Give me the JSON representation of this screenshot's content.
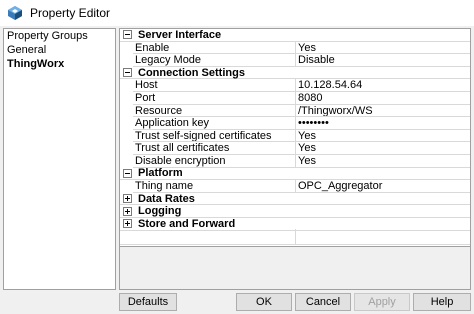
{
  "window": {
    "title": "Property Editor",
    "icon": "thingworx-app-icon"
  },
  "groups": {
    "items": [
      {
        "label": "Property Groups",
        "bold": false
      },
      {
        "label": "General",
        "bold": false
      },
      {
        "label": "ThingWorx",
        "bold": true
      }
    ]
  },
  "grid": {
    "categories": [
      {
        "label": "Server Interface",
        "expanded": true,
        "props": [
          {
            "name": "Enable",
            "value": "Yes"
          },
          {
            "name": "Legacy Mode",
            "value": "Disable"
          }
        ]
      },
      {
        "label": "Connection Settings",
        "expanded": true,
        "props": [
          {
            "name": "Host",
            "value": "10.128.54.64"
          },
          {
            "name": "Port",
            "value": "8080"
          },
          {
            "name": "Resource",
            "value": "/Thingworx/WS"
          },
          {
            "name": "Application key",
            "value": "••••••••"
          },
          {
            "name": "Trust self-signed certificates",
            "value": "Yes"
          },
          {
            "name": "Trust all certificates",
            "value": "Yes"
          },
          {
            "name": "Disable encryption",
            "value": "Yes"
          }
        ]
      },
      {
        "label": "Platform",
        "expanded": true,
        "props": [
          {
            "name": "Thing name",
            "value": "OPC_Aggregator"
          }
        ]
      },
      {
        "label": "Data Rates",
        "expanded": false,
        "props": []
      },
      {
        "label": "Logging",
        "expanded": false,
        "props": []
      },
      {
        "label": "Store and Forward",
        "expanded": false,
        "props": []
      }
    ]
  },
  "buttons": {
    "defaults": "Defaults",
    "ok": "OK",
    "cancel": "Cancel",
    "apply": "Apply",
    "help": "Help"
  }
}
